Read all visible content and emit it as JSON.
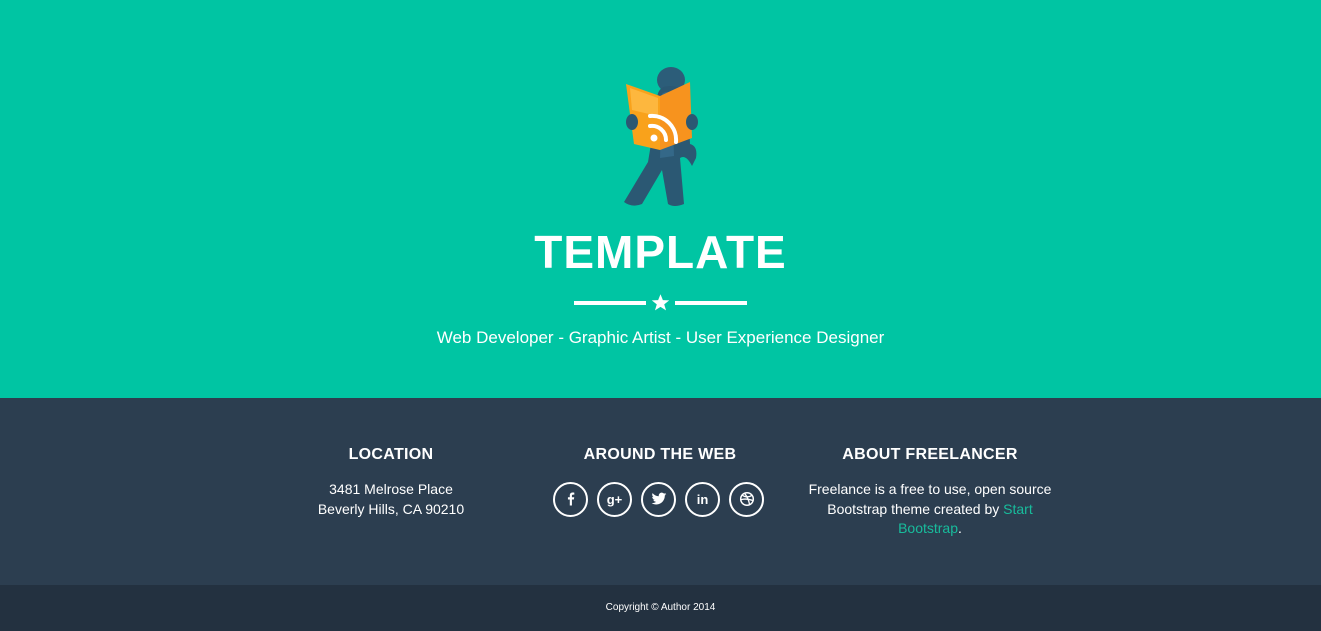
{
  "hero": {
    "title": "TEMPLATE",
    "subtitle": "Web Developer - Graphic Artist - User Experience Designer",
    "mascot_icon": "rss-reader-mascot-icon",
    "divider_icon": "star-icon"
  },
  "footer": {
    "location": {
      "heading": "LOCATION",
      "line1": "3481 Melrose Place",
      "line2": "Beverly Hills, CA 90210"
    },
    "web": {
      "heading": "AROUND THE WEB",
      "social": [
        {
          "icon": "facebook-icon",
          "glyph": "f"
        },
        {
          "icon": "google-plus-icon",
          "glyph": "g+"
        },
        {
          "icon": "twitter-icon",
          "glyph": "t"
        },
        {
          "icon": "linkedin-icon",
          "glyph": "in"
        },
        {
          "icon": "dribbble-icon",
          "glyph": ""
        }
      ]
    },
    "about": {
      "heading": "ABOUT FREELANCER",
      "text_before": "Freelance is a free to use, open source Bootstrap theme created by ",
      "link_text": "Start Bootstrap",
      "text_after": "."
    }
  },
  "copyright": "Copyright © Author 2014",
  "colors": {
    "hero_bg": "#00c5a3",
    "footer_bg": "#2c3e50",
    "bottom_bg": "#233140",
    "link": "#18bc9c"
  }
}
